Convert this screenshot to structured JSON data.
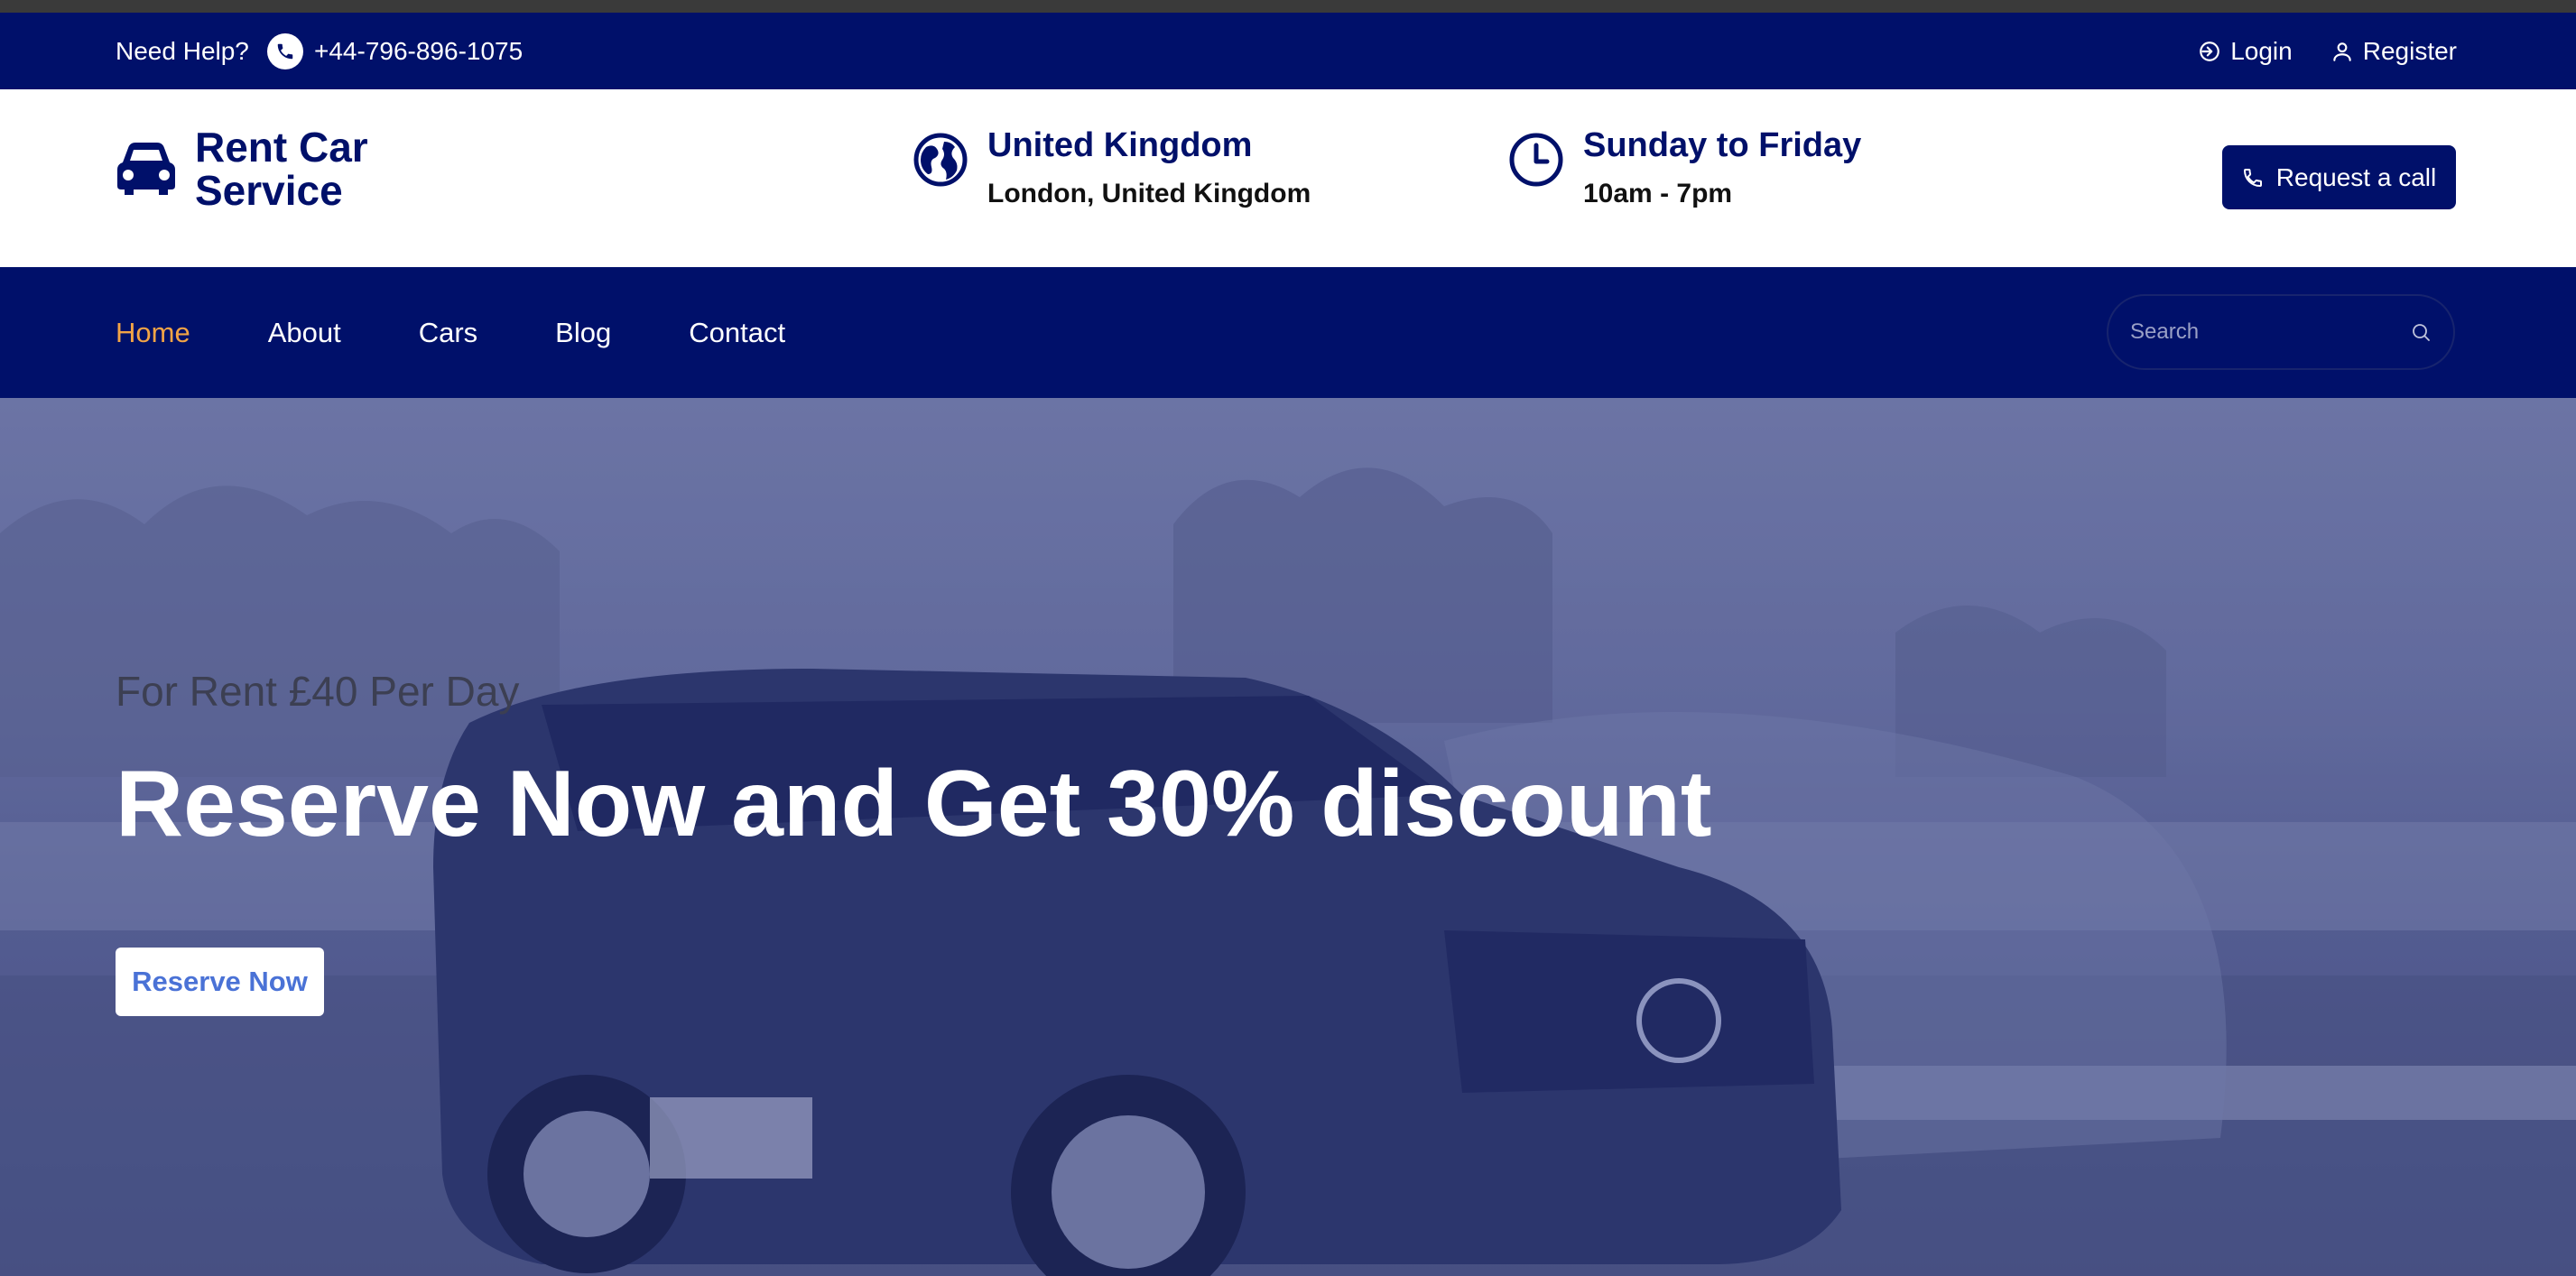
{
  "topbar": {
    "help_label": "Need Help?",
    "phone": "+44-796-896-1075",
    "login_label": "Login",
    "register_label": "Register"
  },
  "header": {
    "logo_text": "Rent Car Service",
    "location_title": "United Kingdom",
    "location_sub": "London, United Kingdom",
    "hours_title": "Sunday to Friday",
    "hours_sub": "10am - 7pm",
    "request_call_label": "Request a call"
  },
  "nav": {
    "items": [
      {
        "label": "Home",
        "active": true
      },
      {
        "label": "About",
        "active": false
      },
      {
        "label": "Cars",
        "active": false
      },
      {
        "label": "Blog",
        "active": false
      },
      {
        "label": "Contact",
        "active": false
      }
    ],
    "search_placeholder": "Search"
  },
  "hero": {
    "subtitle": "For Rent £40 Per Day",
    "title": "Reserve Now and Get 30% discount",
    "cta_label": "Reserve Now"
  },
  "colors": {
    "brand": "#00106a",
    "active_nav": "#f2a446",
    "cta_text": "#4a72d6"
  },
  "icons": {
    "phone": "phone-icon",
    "login": "login-icon",
    "register": "user-icon",
    "logo": "car-icon",
    "location": "globe-icon",
    "hours": "clock-icon",
    "request": "phone-icon",
    "search": "search-icon"
  }
}
